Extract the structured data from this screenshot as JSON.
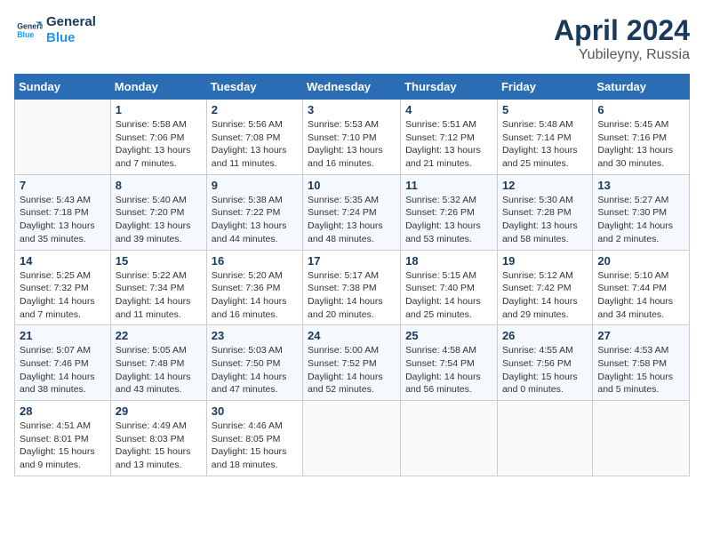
{
  "header": {
    "logo_line1": "General",
    "logo_line2": "Blue",
    "month": "April 2024",
    "location": "Yubileyny, Russia"
  },
  "days_of_week": [
    "Sunday",
    "Monday",
    "Tuesday",
    "Wednesday",
    "Thursday",
    "Friday",
    "Saturday"
  ],
  "weeks": [
    [
      {
        "num": "",
        "info": ""
      },
      {
        "num": "1",
        "info": "Sunrise: 5:58 AM\nSunset: 7:06 PM\nDaylight: 13 hours\nand 7 minutes."
      },
      {
        "num": "2",
        "info": "Sunrise: 5:56 AM\nSunset: 7:08 PM\nDaylight: 13 hours\nand 11 minutes."
      },
      {
        "num": "3",
        "info": "Sunrise: 5:53 AM\nSunset: 7:10 PM\nDaylight: 13 hours\nand 16 minutes."
      },
      {
        "num": "4",
        "info": "Sunrise: 5:51 AM\nSunset: 7:12 PM\nDaylight: 13 hours\nand 21 minutes."
      },
      {
        "num": "5",
        "info": "Sunrise: 5:48 AM\nSunset: 7:14 PM\nDaylight: 13 hours\nand 25 minutes."
      },
      {
        "num": "6",
        "info": "Sunrise: 5:45 AM\nSunset: 7:16 PM\nDaylight: 13 hours\nand 30 minutes."
      }
    ],
    [
      {
        "num": "7",
        "info": "Sunrise: 5:43 AM\nSunset: 7:18 PM\nDaylight: 13 hours\nand 35 minutes."
      },
      {
        "num": "8",
        "info": "Sunrise: 5:40 AM\nSunset: 7:20 PM\nDaylight: 13 hours\nand 39 minutes."
      },
      {
        "num": "9",
        "info": "Sunrise: 5:38 AM\nSunset: 7:22 PM\nDaylight: 13 hours\nand 44 minutes."
      },
      {
        "num": "10",
        "info": "Sunrise: 5:35 AM\nSunset: 7:24 PM\nDaylight: 13 hours\nand 48 minutes."
      },
      {
        "num": "11",
        "info": "Sunrise: 5:32 AM\nSunset: 7:26 PM\nDaylight: 13 hours\nand 53 minutes."
      },
      {
        "num": "12",
        "info": "Sunrise: 5:30 AM\nSunset: 7:28 PM\nDaylight: 13 hours\nand 58 minutes."
      },
      {
        "num": "13",
        "info": "Sunrise: 5:27 AM\nSunset: 7:30 PM\nDaylight: 14 hours\nand 2 minutes."
      }
    ],
    [
      {
        "num": "14",
        "info": "Sunrise: 5:25 AM\nSunset: 7:32 PM\nDaylight: 14 hours\nand 7 minutes."
      },
      {
        "num": "15",
        "info": "Sunrise: 5:22 AM\nSunset: 7:34 PM\nDaylight: 14 hours\nand 11 minutes."
      },
      {
        "num": "16",
        "info": "Sunrise: 5:20 AM\nSunset: 7:36 PM\nDaylight: 14 hours\nand 16 minutes."
      },
      {
        "num": "17",
        "info": "Sunrise: 5:17 AM\nSunset: 7:38 PM\nDaylight: 14 hours\nand 20 minutes."
      },
      {
        "num": "18",
        "info": "Sunrise: 5:15 AM\nSunset: 7:40 PM\nDaylight: 14 hours\nand 25 minutes."
      },
      {
        "num": "19",
        "info": "Sunrise: 5:12 AM\nSunset: 7:42 PM\nDaylight: 14 hours\nand 29 minutes."
      },
      {
        "num": "20",
        "info": "Sunrise: 5:10 AM\nSunset: 7:44 PM\nDaylight: 14 hours\nand 34 minutes."
      }
    ],
    [
      {
        "num": "21",
        "info": "Sunrise: 5:07 AM\nSunset: 7:46 PM\nDaylight: 14 hours\nand 38 minutes."
      },
      {
        "num": "22",
        "info": "Sunrise: 5:05 AM\nSunset: 7:48 PM\nDaylight: 14 hours\nand 43 minutes."
      },
      {
        "num": "23",
        "info": "Sunrise: 5:03 AM\nSunset: 7:50 PM\nDaylight: 14 hours\nand 47 minutes."
      },
      {
        "num": "24",
        "info": "Sunrise: 5:00 AM\nSunset: 7:52 PM\nDaylight: 14 hours\nand 52 minutes."
      },
      {
        "num": "25",
        "info": "Sunrise: 4:58 AM\nSunset: 7:54 PM\nDaylight: 14 hours\nand 56 minutes."
      },
      {
        "num": "26",
        "info": "Sunrise: 4:55 AM\nSunset: 7:56 PM\nDaylight: 15 hours\nand 0 minutes."
      },
      {
        "num": "27",
        "info": "Sunrise: 4:53 AM\nSunset: 7:58 PM\nDaylight: 15 hours\nand 5 minutes."
      }
    ],
    [
      {
        "num": "28",
        "info": "Sunrise: 4:51 AM\nSunset: 8:01 PM\nDaylight: 15 hours\nand 9 minutes."
      },
      {
        "num": "29",
        "info": "Sunrise: 4:49 AM\nSunset: 8:03 PM\nDaylight: 15 hours\nand 13 minutes."
      },
      {
        "num": "30",
        "info": "Sunrise: 4:46 AM\nSunset: 8:05 PM\nDaylight: 15 hours\nand 18 minutes."
      },
      {
        "num": "",
        "info": ""
      },
      {
        "num": "",
        "info": ""
      },
      {
        "num": "",
        "info": ""
      },
      {
        "num": "",
        "info": ""
      }
    ]
  ]
}
